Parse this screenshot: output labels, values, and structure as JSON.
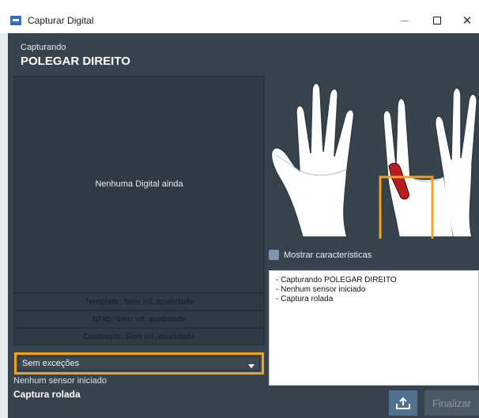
{
  "window": {
    "title": "Capturar Digital",
    "minimize_icon": "minimize-icon",
    "maximize_icon": "maximize-icon",
    "close_glyph": "✕"
  },
  "header": {
    "status_label": "Capturando",
    "finger_name": "POLEGAR DIREITO"
  },
  "preview": {
    "empty_text": "Nenhuma Digital ainda"
  },
  "quality": {
    "template": "Template: Sem inf. qualidade",
    "nfiq": "NFIQ: Sem inf. qualidade",
    "contrast": "Contraste: Sem inf. qualidade"
  },
  "exceptions_select": {
    "selected": "Sem exceções"
  },
  "status": {
    "sensor": "Nenhum sensor iniciado",
    "mode": "Captura rolada"
  },
  "hands_image": {
    "highlighted_finger": "right thumb",
    "highlight_color": "#b81c1c",
    "selection_color": "#f3a21c"
  },
  "options": {
    "show_features_label": "Mostrar características",
    "show_features_checked": false
  },
  "log": {
    "lines": [
      "- Capturando POLEGAR DIREITO",
      "- Nenhum sensor iniciado",
      "- Captura rolada"
    ]
  },
  "actions": {
    "upload_icon": "upload-icon",
    "finish_label": "Finalizar"
  },
  "colors": {
    "background": "#37434d",
    "accent": "#f3a21c"
  }
}
